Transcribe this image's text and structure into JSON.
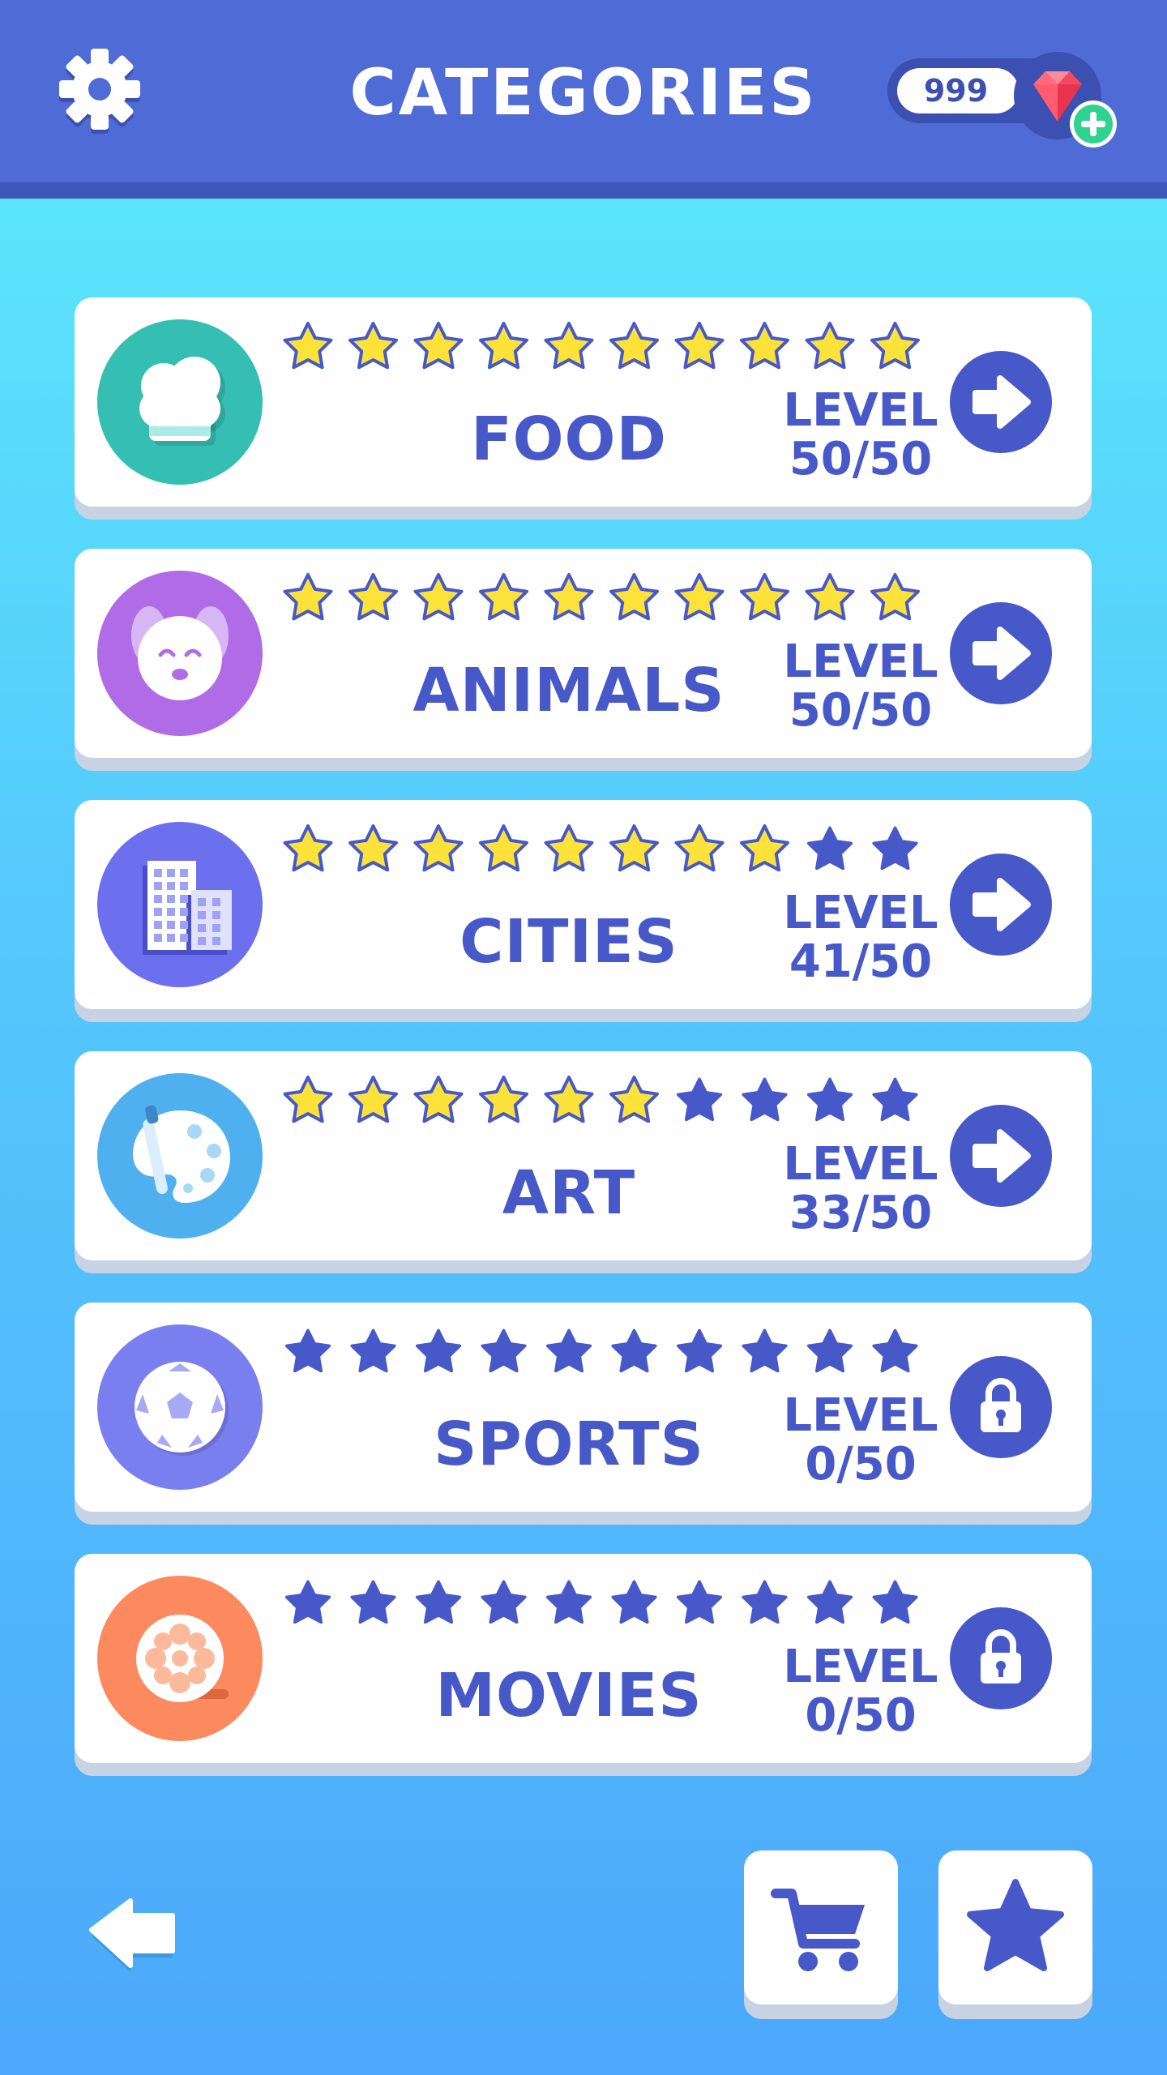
{
  "header": {
    "title": "CATEGORIES",
    "gems": "999",
    "settings_icon": "gear-icon",
    "gem_icon": "ruby-gem-icon",
    "add_gems_icon": "plus-icon"
  },
  "colors": {
    "header_bg": "#4f6bd6",
    "accent_text": "#4758c8",
    "star_filled": "#fde23a",
    "star_empty": "#4758c8"
  },
  "categories": [
    {
      "name": "FOOD",
      "level_label": "LEVEL",
      "level": "50/50",
      "stars_filled": 10,
      "stars_total": 10,
      "locked": false,
      "icon": "chef-hat-icon",
      "icon_color": "#35bfb2"
    },
    {
      "name": "ANIMALS",
      "level_label": "LEVEL",
      "level": "50/50",
      "stars_filled": 10,
      "stars_total": 10,
      "locked": false,
      "icon": "dog-icon",
      "icon_color": "#b06ce6"
    },
    {
      "name": "CITIES",
      "level_label": "LEVEL",
      "level": "41/50",
      "stars_filled": 8,
      "stars_total": 10,
      "locked": false,
      "icon": "buildings-icon",
      "icon_color": "#6c70ee"
    },
    {
      "name": "ART",
      "level_label": "LEVEL",
      "level": "33/50",
      "stars_filled": 6,
      "stars_total": 10,
      "locked": false,
      "icon": "palette-icon",
      "icon_color": "#4fb0ef"
    },
    {
      "name": "SPORTS",
      "level_label": "LEVEL",
      "level": "0/50",
      "stars_filled": 0,
      "stars_total": 10,
      "locked": true,
      "icon": "soccer-ball-icon",
      "icon_color": "#7a7ff0"
    },
    {
      "name": "MOVIES",
      "level_label": "LEVEL",
      "level": "0/50",
      "stars_filled": 0,
      "stars_total": 10,
      "locked": true,
      "icon": "film-reel-icon",
      "icon_color": "#fc8a5e"
    }
  ],
  "footer": {
    "back_icon": "back-arrow-icon",
    "shop_icon": "shopping-cart-icon",
    "favorites_icon": "star-icon"
  }
}
